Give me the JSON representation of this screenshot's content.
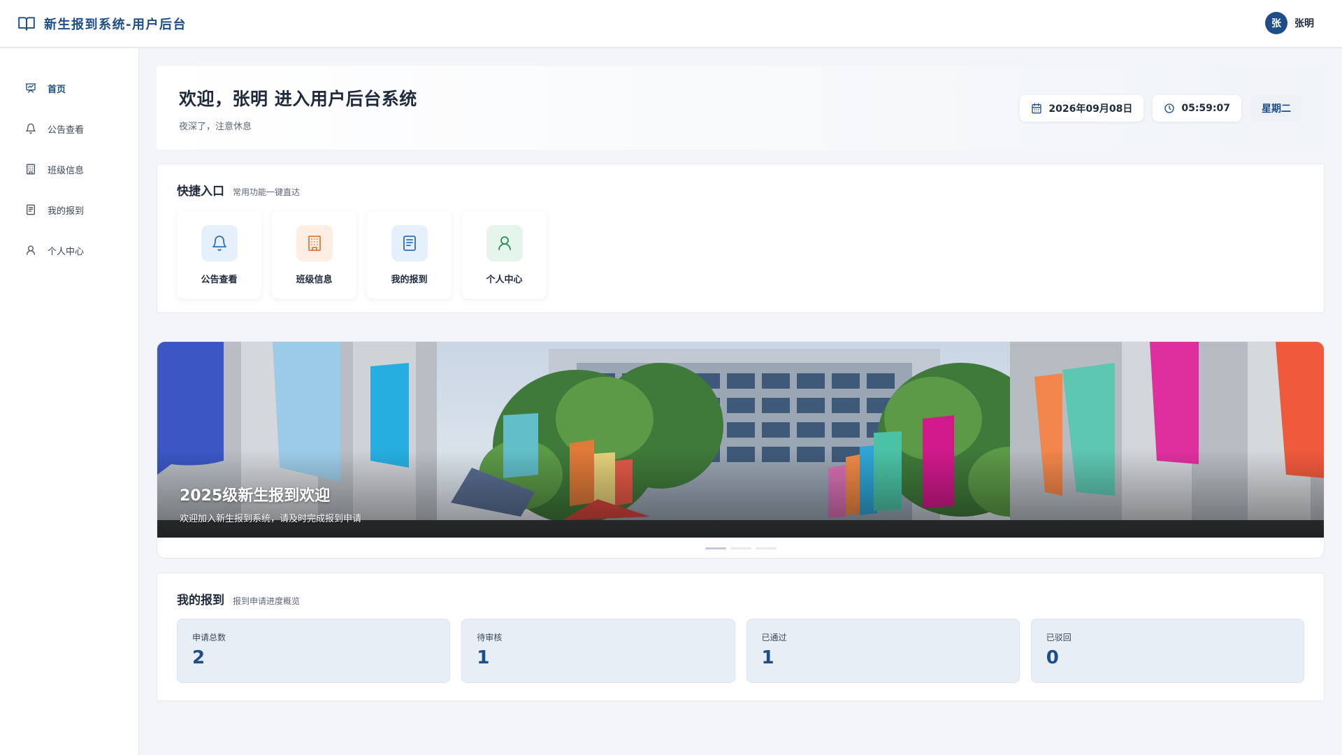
{
  "header": {
    "title": "新生报到系统-用户后台",
    "avatar_text": "张",
    "user_name": "张明"
  },
  "sidebar": {
    "items": [
      {
        "label": "首页",
        "icon": "presentation-icon",
        "active": true
      },
      {
        "label": "公告查看",
        "icon": "bell-icon"
      },
      {
        "label": "班级信息",
        "icon": "building-icon"
      },
      {
        "label": "我的报到",
        "icon": "document-icon"
      },
      {
        "label": "个人中心",
        "icon": "user-icon"
      }
    ]
  },
  "welcome": {
    "title": "欢迎，张明 进入用户后台系统",
    "subtitle": "夜深了，注意休息",
    "date": "2026年09月08日",
    "time": "05:59:07",
    "weekday": "星期二"
  },
  "quick": {
    "title": "快捷入口",
    "subtitle": "常用功能一键直达",
    "items": [
      {
        "label": "公告查看",
        "icon": "bell-icon",
        "color": "#2f6fb5",
        "bg": "#e6f0fb"
      },
      {
        "label": "班级信息",
        "icon": "building-icon",
        "color": "#e07b39",
        "bg": "#fdeee3"
      },
      {
        "label": "我的报到",
        "icon": "document-icon",
        "color": "#2f6fb5",
        "bg": "#e6f0fb"
      },
      {
        "label": "个人中心",
        "icon": "user-icon",
        "color": "#2e8b57",
        "bg": "#e5f5ec"
      }
    ]
  },
  "banner": {
    "title": "2025级新生报到欢迎",
    "description": "欢迎加入新生报到系统，请及时完成报到申请",
    "slides": 3,
    "active_slide": 1
  },
  "stats": {
    "title": "我的报到",
    "subtitle": "报到申请进度概览",
    "items": [
      {
        "label": "申请总数",
        "value": "2"
      },
      {
        "label": "待审核",
        "value": "1"
      },
      {
        "label": "已通过",
        "value": "1"
      },
      {
        "label": "已驳回",
        "value": "0"
      }
    ]
  },
  "colors": {
    "primary": "#1d4e89",
    "text": "#1f2a3d",
    "background": "#f3f5f8"
  }
}
